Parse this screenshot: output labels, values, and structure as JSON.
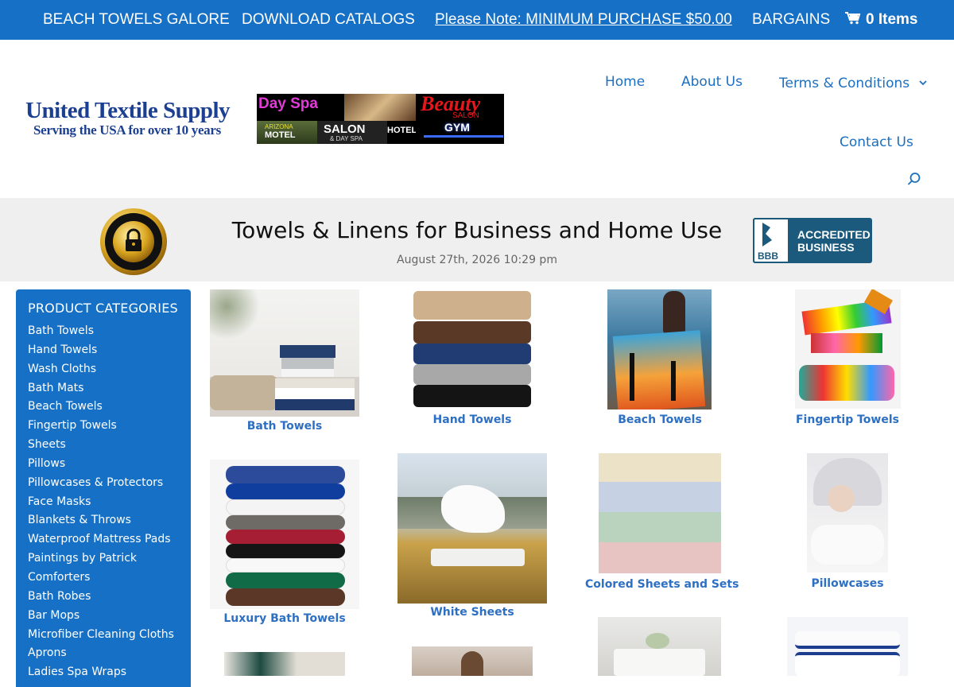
{
  "topbar": {
    "items": [
      "BEACH TOWELS GALORE",
      "DOWNLOAD CATALOGS",
      "Please Note: MINIMUM PURCHASE $50.00",
      "BARGAINS"
    ],
    "cart_label": "0 Items"
  },
  "header": {
    "logo_title": "United Textile Supply",
    "logo_subtitle": "Serving the USA for over 10 years",
    "banner": {
      "day_spa": "Day Spa",
      "beauty": "Beauty",
      "salon_small": "SALON",
      "gym": "GYM",
      "arizona": "ARIZONA",
      "motel": "MOTEL",
      "salon": "SALON",
      "day_spa_small": "& DAY SPA",
      "hotel": "HOTEL"
    },
    "nav": {
      "home": "Home",
      "about": "About Us",
      "terms": "Terms & Conditions",
      "contact": "Contact Us"
    }
  },
  "band": {
    "title": "Towels & Linens for Business and Home Use",
    "date": "August 27th, 2026 10:29 pm",
    "seal_text": "100% SECURE",
    "bbb_line1": "ACCREDITED",
    "bbb_line2": "BUSINESS",
    "bbb_mark": "BBB"
  },
  "sidebar": {
    "title": "PRODUCT CATEGORIES",
    "items": [
      "Bath Towels",
      "Hand Towels",
      "Wash Cloths",
      "Bath Mats",
      "Beach Towels",
      "Fingertip Towels",
      "Sheets",
      "Pillows",
      "Pillowcases & Protectors",
      "Face Masks",
      "Blankets & Throws",
      "Waterproof Mattress Pads",
      "Paintings by Patrick",
      "Comforters",
      "Bath Robes",
      "Bar Mops",
      "Microfiber Cleaning Cloths",
      "Aprons",
      "Ladies Spa Wraps"
    ]
  },
  "products": [
    "Bath Towels",
    "Hand Towels",
    "Beach Towels",
    "Fingertip Towels",
    "Luxury Bath Towels",
    "White Sheets",
    "Colored Sheets and Sets",
    "Pillowcases"
  ],
  "colors": {
    "brand_blue": "#1570c6",
    "link_blue": "#1c6fbf",
    "band_gray": "#efefef"
  }
}
